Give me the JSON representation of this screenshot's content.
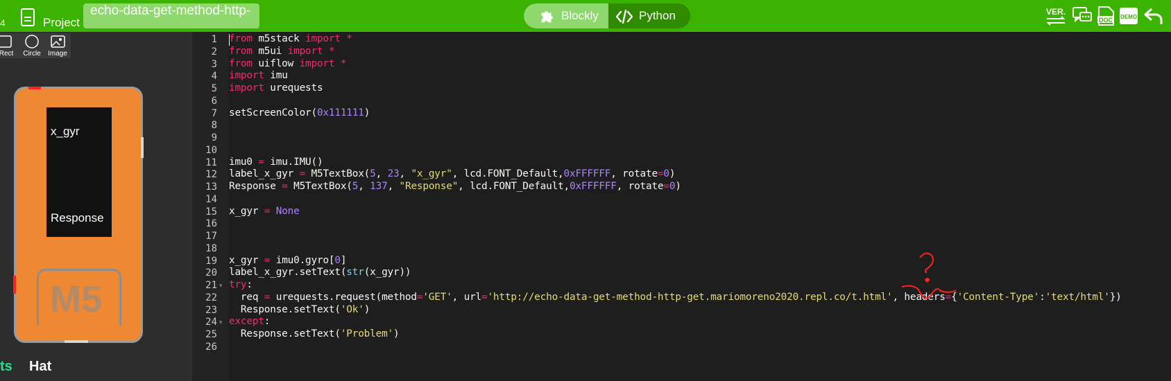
{
  "topbar": {
    "version_number": "4",
    "project_label": "Project",
    "file_name": "echo-data-get-method-http-",
    "mode_toggle": {
      "blockly_label": "Blockly",
      "python_label": "Python"
    },
    "icons": [
      "version-icon",
      "chat-icon",
      "doc-icon",
      "demo-icon",
      "undo-icon"
    ],
    "ver_text": "VER.",
    "doc_text": "DOC",
    "demo_text": "DEMO"
  },
  "sidebar": {
    "shape_tools": [
      {
        "label": "Rect",
        "icon": "rect-icon"
      },
      {
        "label": "Circle",
        "icon": "circle-icon"
      },
      {
        "label": "Image",
        "icon": "image-icon"
      }
    ],
    "device": {
      "screen_labels": [
        "x_gyr",
        "Response"
      ],
      "logo_text": "M5"
    },
    "tabs": [
      "ts",
      "Hat"
    ]
  },
  "editor": {
    "colors": {
      "keyword": "#f92672",
      "number": "#ae81ff",
      "string": "#e6db74",
      "builtin": "#66d9ef",
      "text": "#f8f8f2"
    },
    "lines": [
      {
        "n": "1",
        "tokens": [
          [
            "kw",
            "from"
          ],
          [
            "t",
            " m5stack "
          ],
          [
            "kw",
            "import"
          ],
          [
            "op",
            " *"
          ]
        ]
      },
      {
        "n": "2",
        "tokens": [
          [
            "kw",
            "from"
          ],
          [
            "t",
            " m5ui "
          ],
          [
            "kw",
            "import"
          ],
          [
            "op",
            " *"
          ]
        ]
      },
      {
        "n": "3",
        "tokens": [
          [
            "kw",
            "from"
          ],
          [
            "t",
            " uiflow "
          ],
          [
            "kw",
            "import"
          ],
          [
            "op",
            " *"
          ]
        ]
      },
      {
        "n": "4",
        "tokens": [
          [
            "kw",
            "import"
          ],
          [
            "t",
            " imu"
          ]
        ]
      },
      {
        "n": "5",
        "tokens": [
          [
            "kw",
            "import"
          ],
          [
            "t",
            " urequests"
          ]
        ]
      },
      {
        "n": "6",
        "tokens": []
      },
      {
        "n": "7",
        "tokens": [
          [
            "t",
            "setScreenColor("
          ],
          [
            "num",
            "0x111111"
          ],
          [
            "t",
            ")"
          ]
        ]
      },
      {
        "n": "8",
        "tokens": []
      },
      {
        "n": "9",
        "tokens": []
      },
      {
        "n": "10",
        "tokens": []
      },
      {
        "n": "11",
        "tokens": [
          [
            "t",
            "imu0 "
          ],
          [
            "op",
            "="
          ],
          [
            "t",
            " imu.IMU()"
          ]
        ]
      },
      {
        "n": "12",
        "tokens": [
          [
            "t",
            "label_x_gyr "
          ],
          [
            "op",
            "="
          ],
          [
            "t",
            " M5TextBox("
          ],
          [
            "num",
            "5"
          ],
          [
            "t",
            ", "
          ],
          [
            "num",
            "23"
          ],
          [
            "t",
            ", "
          ],
          [
            "str",
            "\"x_gyr\""
          ],
          [
            "t",
            ", lcd.FONT_Default,"
          ],
          [
            "num",
            "0xFFFFFF"
          ],
          [
            "t",
            ", rotate"
          ],
          [
            "op",
            "="
          ],
          [
            "num",
            "0"
          ],
          [
            "t",
            ")"
          ]
        ]
      },
      {
        "n": "13",
        "tokens": [
          [
            "t",
            "Response "
          ],
          [
            "op",
            "="
          ],
          [
            "t",
            " M5TextBox("
          ],
          [
            "num",
            "5"
          ],
          [
            "t",
            ", "
          ],
          [
            "num",
            "137"
          ],
          [
            "t",
            ", "
          ],
          [
            "str",
            "\"Response\""
          ],
          [
            "t",
            ", lcd.FONT_Default,"
          ],
          [
            "num",
            "0xFFFFFF"
          ],
          [
            "t",
            ", rotate"
          ],
          [
            "op",
            "="
          ],
          [
            "num",
            "0"
          ],
          [
            "t",
            ")"
          ]
        ]
      },
      {
        "n": "14",
        "tokens": []
      },
      {
        "n": "15",
        "tokens": [
          [
            "t",
            "x_gyr "
          ],
          [
            "op",
            "="
          ],
          [
            "num",
            " None"
          ]
        ]
      },
      {
        "n": "16",
        "tokens": []
      },
      {
        "n": "17",
        "tokens": []
      },
      {
        "n": "18",
        "tokens": []
      },
      {
        "n": "19",
        "tokens": [
          [
            "t",
            "x_gyr "
          ],
          [
            "op",
            "="
          ],
          [
            "t",
            " imu0.gyro["
          ],
          [
            "num",
            "0"
          ],
          [
            "t",
            "]"
          ]
        ]
      },
      {
        "n": "20",
        "tokens": [
          [
            "t",
            "label_x_gyr.setText("
          ],
          [
            "fn",
            "str"
          ],
          [
            "t",
            "(x_gyr))"
          ]
        ]
      },
      {
        "n": "21",
        "fold": true,
        "tokens": [
          [
            "kw",
            "try"
          ],
          [
            "t",
            ":"
          ]
        ]
      },
      {
        "n": "22",
        "tokens": [
          [
            "t",
            "  req "
          ],
          [
            "op",
            "="
          ],
          [
            "t",
            " urequests.request(method"
          ],
          [
            "op",
            "="
          ],
          [
            "str",
            "'GET'"
          ],
          [
            "t",
            ", url"
          ],
          [
            "op",
            "="
          ],
          [
            "str",
            "'http://echo-data-get-method-http-get.mariomoreno2020.repl.co/t.html'"
          ],
          [
            "t",
            ", headers"
          ],
          [
            "op",
            "="
          ],
          [
            "t",
            "{"
          ],
          [
            "str",
            "'Content-Type'"
          ],
          [
            "t",
            ":"
          ],
          [
            "str",
            "'text/html'"
          ],
          [
            "t",
            "})"
          ]
        ]
      },
      {
        "n": "23",
        "tokens": [
          [
            "t",
            "  Response.setText("
          ],
          [
            "str",
            "'Ok'"
          ],
          [
            "t",
            ")"
          ]
        ]
      },
      {
        "n": "24",
        "fold": true,
        "tokens": [
          [
            "kw",
            "except"
          ],
          [
            "t",
            ":"
          ]
        ]
      },
      {
        "n": "25",
        "tokens": [
          [
            "t",
            "  Response.setText("
          ],
          [
            "str",
            "'Problem'"
          ],
          [
            "t",
            ")"
          ]
        ]
      },
      {
        "n": "26",
        "tokens": []
      }
    ]
  }
}
